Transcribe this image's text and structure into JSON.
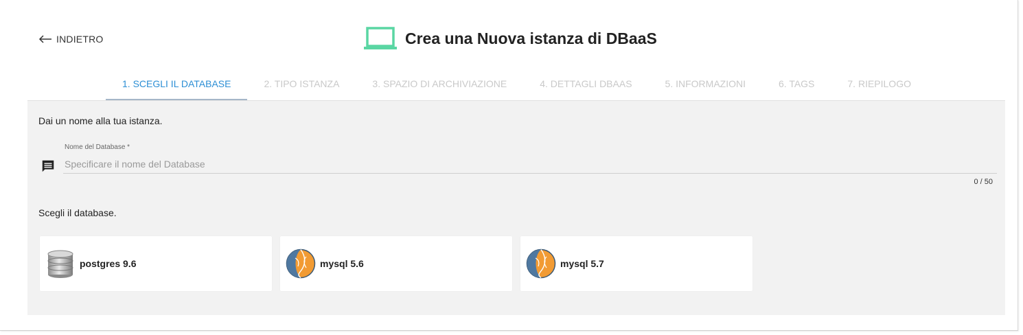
{
  "header": {
    "back_label": "INDIETRO",
    "title": "Crea una Nuova istanza di DBaaS",
    "title_icon": "laptop-icon",
    "accent_color": "#5ad6a3"
  },
  "steps": [
    {
      "label": "1. SCEGLI IL DATABASE",
      "active": true
    },
    {
      "label": "2. TIPO ISTANZA",
      "active": false
    },
    {
      "label": "3. SPAZIO DI ARCHIVIAZIONE",
      "active": false
    },
    {
      "label": "4. DETTAGLI DBAAS",
      "active": false
    },
    {
      "label": "5. INFORMAZIONI",
      "active": false
    },
    {
      "label": "6. TAGS",
      "active": false
    },
    {
      "label": "7. RIEPILOGO",
      "active": false
    }
  ],
  "form": {
    "name_prompt": "Dai un nome alla tua istanza.",
    "field_label": "Nome del Database *",
    "field_placeholder": "Specificare il nome del Database",
    "field_value": "",
    "field_icon": "message-icon",
    "counter": "0 / 50",
    "db_prompt": "Scegli il database."
  },
  "databases": [
    {
      "name": "postgres 9.6",
      "icon": "database-cylinder-icon"
    },
    {
      "name": "mysql 5.6",
      "icon": "mysql-dolphin-icon"
    },
    {
      "name": "mysql 5.7",
      "icon": "mysql-dolphin-icon"
    }
  ]
}
